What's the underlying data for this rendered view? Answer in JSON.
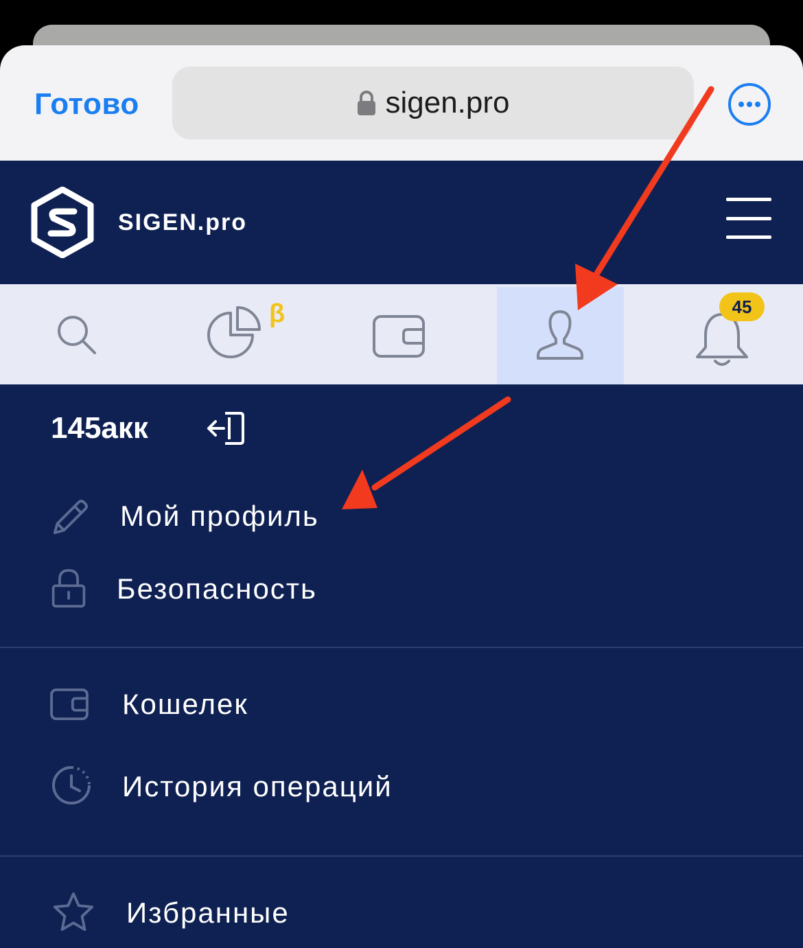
{
  "browser": {
    "done_label": "Готово",
    "url": "sigen.pro"
  },
  "header": {
    "site_name": "SIGEN.pro"
  },
  "tabs": {
    "items": [
      {
        "name": "search",
        "icon": "search-icon"
      },
      {
        "name": "stats",
        "icon": "pie-chart-icon",
        "beta": "β"
      },
      {
        "name": "wallet",
        "icon": "wallet-icon"
      },
      {
        "name": "profile",
        "icon": "user-icon",
        "active": true
      },
      {
        "name": "notifications",
        "icon": "bell-icon",
        "badge": "45"
      }
    ]
  },
  "account": {
    "name": "145акк"
  },
  "menu": {
    "items": [
      {
        "label": "Мой профиль",
        "icon": "pencil-icon"
      },
      {
        "label": "Безопасность",
        "icon": "lock-icon"
      },
      {
        "label": "Кошелек",
        "icon": "wallet-icon"
      },
      {
        "label": "История операций",
        "icon": "history-clock-icon"
      },
      {
        "label": "Избранные",
        "icon": "star-icon"
      }
    ]
  },
  "colors": {
    "navy": "#0f2152",
    "tabbar": "#e8ebf6",
    "active_tab": "#d4e0fb",
    "accent_blue": "#1a7ef2",
    "badge_yellow": "#f2c318",
    "annotation_red": "#f23a1e"
  }
}
